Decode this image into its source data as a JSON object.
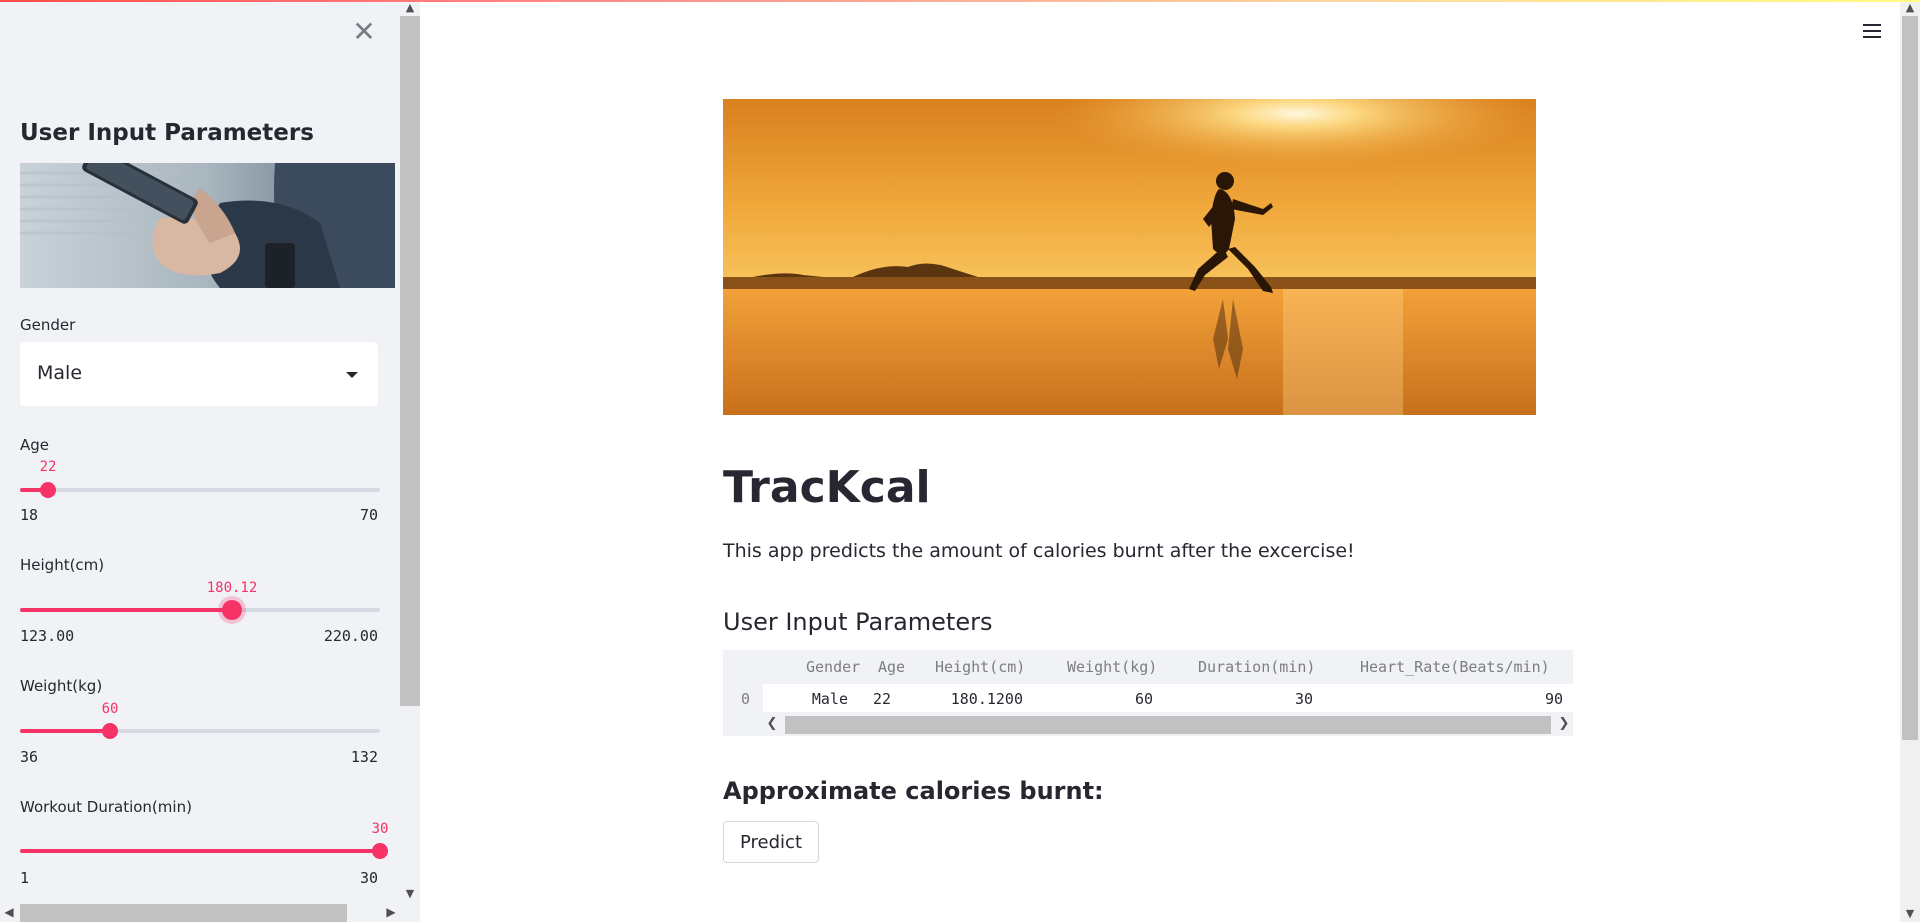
{
  "sidebar": {
    "title": "User Input Parameters",
    "close_icon": "close-icon",
    "gender": {
      "label": "Gender",
      "value": "Male"
    },
    "sliders": [
      {
        "label": "Age",
        "value": "22",
        "min": "18",
        "max": "70",
        "fraction": 0.077
      },
      {
        "label": "Height(cm)",
        "value": "180.12",
        "min": "123.00",
        "max": "220.00",
        "fraction": 0.589
      },
      {
        "label": "Weight(kg)",
        "value": "60",
        "min": "36",
        "max": "132",
        "fraction": 0.25
      },
      {
        "label": "Workout Duration(min)",
        "value": "30",
        "min": "1",
        "max": "30",
        "fraction": 1.0
      }
    ]
  },
  "main": {
    "menu_icon": "hamburger-menu-icon",
    "title": "TracKcal",
    "description": "This app predicts the amount of calories burnt after the excercise!",
    "input_section_title": "User Input Parameters",
    "table": {
      "columns": [
        "Gender",
        "Age",
        "Height(cm)",
        "Weight(kg)",
        "Duration(min)",
        "Heart_Rate(Beats/min)"
      ],
      "rows": [
        {
          "index": "0",
          "cells": [
            "Male",
            "22",
            "180.1200",
            "60",
            "30",
            "90"
          ]
        }
      ]
    },
    "result_section_title": "Approximate calories burnt:",
    "predict_label": "Predict"
  },
  "colors": {
    "accent": "#f63366",
    "sidebar_bg": "#f0f2f6",
    "text": "#262730"
  }
}
